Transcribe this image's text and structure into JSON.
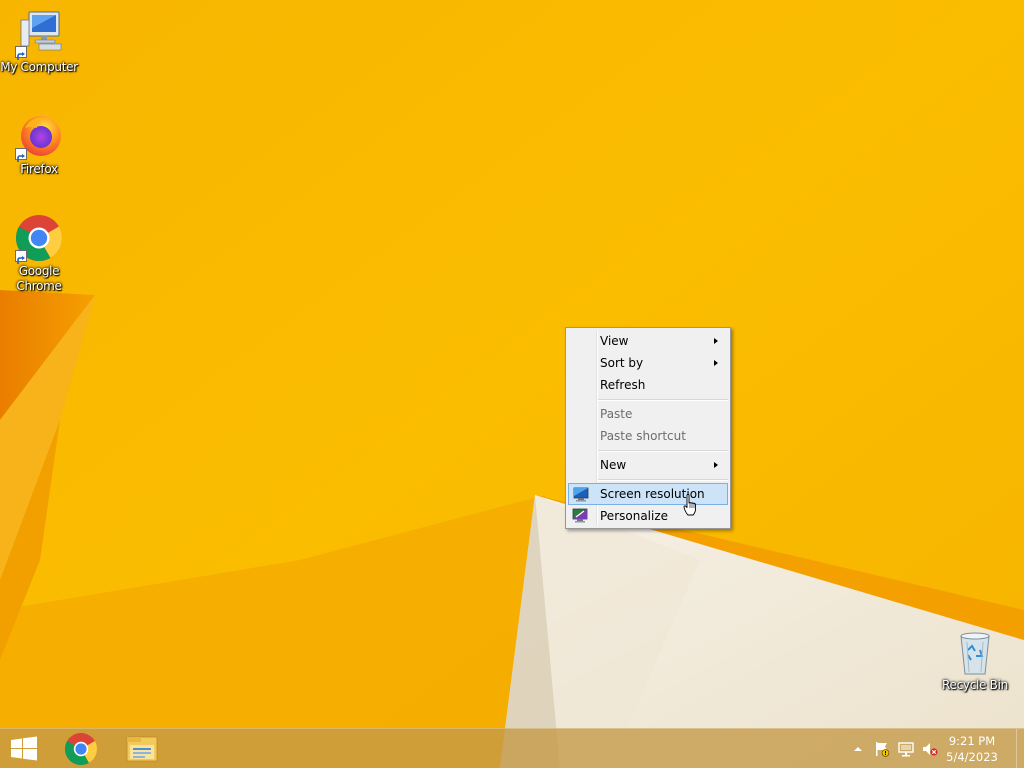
{
  "desktop": {
    "wallpaper": {
      "colors": {
        "base": "#f5b400",
        "light": "#fbc100",
        "orange": "#ee8a00",
        "deep_orange": "#e07a00",
        "cream": "#f3eee2",
        "cream_shadow": "#e6dcc6"
      }
    },
    "icons": [
      {
        "label": "My Computer",
        "icon": "computer-icon"
      },
      {
        "label": "Firefox",
        "icon": "firefox-icon"
      },
      {
        "label": "Google Chrome",
        "icon": "chrome-icon"
      },
      {
        "label": "Recycle Bin",
        "icon": "recycle-bin-icon"
      }
    ]
  },
  "context_menu": {
    "items": [
      {
        "label": "View",
        "has_submenu": true,
        "enabled": true
      },
      {
        "label": "Sort by",
        "has_submenu": true,
        "enabled": true
      },
      {
        "label": "Refresh",
        "has_submenu": false,
        "enabled": true
      },
      {
        "label": "Paste",
        "has_submenu": false,
        "enabled": false
      },
      {
        "label": "Paste shortcut",
        "has_submenu": false,
        "enabled": false
      },
      {
        "label": "New",
        "has_submenu": true,
        "enabled": true
      },
      {
        "label": "Screen resolution",
        "has_submenu": false,
        "enabled": true,
        "icon": "display-settings-icon",
        "highlighted": true
      },
      {
        "label": "Personalize",
        "has_submenu": false,
        "enabled": true,
        "icon": "personalize-icon"
      }
    ],
    "colors": {
      "background": "#f0f0f0",
      "highlight_bg": "#cde3f7",
      "highlight_border": "#7ab0e3",
      "disabled_text": "#6d6d6d"
    }
  },
  "taskbar": {
    "pinned": [
      {
        "icon": "windows-start-icon"
      },
      {
        "icon": "chrome-icon"
      },
      {
        "icon": "file-explorer-icon"
      }
    ],
    "tray_icons": [
      "show-hidden-icons-icon",
      "action-center-flag-icon",
      "network-icon",
      "volume-muted-icon"
    ],
    "clock": {
      "time": "9:21 PM",
      "date": "5/4/2023"
    }
  }
}
